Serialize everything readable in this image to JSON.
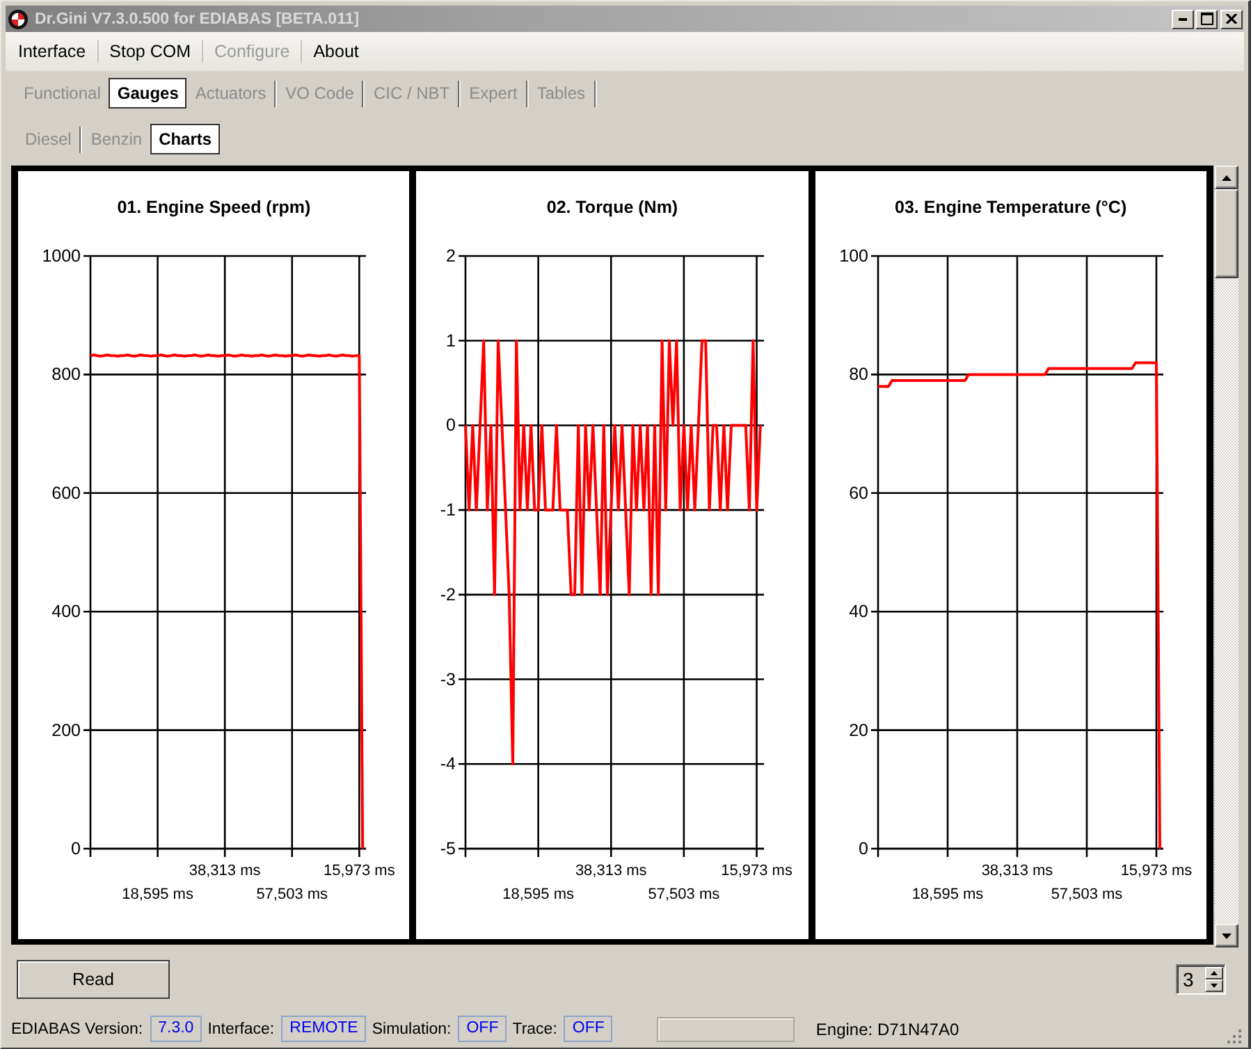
{
  "window": {
    "title": "Dr.Gini V7.3.0.500 for EDIABAS [BETA.011]"
  },
  "menu": [
    {
      "label": "Interface",
      "disabled": false
    },
    {
      "label": "Stop COM",
      "disabled": false
    },
    {
      "label": "Configure",
      "disabled": true
    },
    {
      "label": "About",
      "disabled": false
    }
  ],
  "tabs": [
    {
      "label": "Functional",
      "selected": false
    },
    {
      "label": "Gauges",
      "selected": true
    },
    {
      "label": "Actuators",
      "selected": false
    },
    {
      "label": "VO Code",
      "selected": false
    },
    {
      "label": "CIC / NBT",
      "selected": false
    },
    {
      "label": "Expert",
      "selected": false
    },
    {
      "label": "Tables",
      "selected": false
    }
  ],
  "sub_tabs": [
    {
      "label": "Diesel",
      "selected": false
    },
    {
      "label": "Benzin",
      "selected": false
    },
    {
      "label": "Charts",
      "selected": true
    }
  ],
  "charts": [
    {
      "chart_data": {
        "type": "line",
        "title": "01. Engine Speed (rpm)",
        "grid": true,
        "categories": [
          null,
          null,
          null,
          null,
          null,
          null,
          null,
          null,
          null,
          null,
          null,
          null,
          null,
          null,
          null,
          null,
          null,
          null,
          null,
          null,
          "18,595 ms",
          null,
          null,
          null,
          null,
          null,
          null,
          null,
          null,
          null,
          null,
          null,
          null,
          null,
          null,
          null,
          null,
          null,
          null,
          null,
          "38,313 ms",
          null,
          null,
          null,
          null,
          null,
          null,
          null,
          null,
          null,
          null,
          null,
          null,
          null,
          null,
          null,
          null,
          null,
          null,
          null,
          "57,503 ms",
          null,
          null,
          null,
          null,
          null,
          null,
          null,
          null,
          null,
          null,
          null,
          null,
          null,
          null,
          null,
          null,
          null,
          null,
          null,
          "15,973 ms",
          null
        ],
        "values": [
          832,
          833,
          832,
          831,
          832,
          833,
          832,
          832,
          831,
          832,
          832,
          833,
          832,
          831,
          832,
          833,
          832,
          832,
          831,
          832,
          832,
          833,
          832,
          831,
          832,
          833,
          832,
          832,
          831,
          832,
          832,
          833,
          832,
          831,
          832,
          833,
          832,
          832,
          831,
          832,
          832,
          833,
          832,
          831,
          832,
          833,
          832,
          832,
          831,
          832,
          832,
          833,
          832,
          831,
          832,
          833,
          832,
          832,
          831,
          832,
          832,
          833,
          832,
          831,
          832,
          833,
          832,
          832,
          831,
          832,
          832,
          833,
          832,
          831,
          832,
          833,
          832,
          832,
          831,
          832,
          832,
          0
        ],
        "ylim": [
          0,
          1000
        ],
        "yticks": [
          0,
          200,
          400,
          600,
          800,
          1000
        ]
      }
    },
    {
      "chart_data": {
        "type": "line",
        "title": "02. Torque (Nm)",
        "grid": true,
        "categories": [
          null,
          null,
          null,
          null,
          null,
          null,
          null,
          null,
          null,
          null,
          null,
          null,
          null,
          null,
          null,
          null,
          null,
          null,
          null,
          null,
          "18,595 ms",
          null,
          null,
          null,
          null,
          null,
          null,
          null,
          null,
          null,
          null,
          null,
          null,
          null,
          null,
          null,
          null,
          null,
          null,
          null,
          "38,313 ms",
          null,
          null,
          null,
          null,
          null,
          null,
          null,
          null,
          null,
          null,
          null,
          null,
          null,
          null,
          null,
          null,
          null,
          null,
          null,
          "57,503 ms",
          null,
          null,
          null,
          null,
          null,
          null,
          null,
          null,
          null,
          null,
          null,
          null,
          null,
          null,
          null,
          null,
          null,
          null,
          null,
          "15,973 ms",
          null
        ],
        "values": [
          0,
          -1,
          0,
          -1,
          0,
          1,
          -1,
          0,
          -2,
          1,
          0,
          -1,
          -2,
          -4,
          1,
          -1,
          0,
          -1,
          0,
          -1,
          -1,
          0,
          -1,
          -1,
          -1,
          0,
          -1,
          -1,
          -1,
          -2,
          -2,
          0,
          -2,
          0,
          -1,
          0,
          -1,
          -2,
          0,
          -2,
          -1,
          0,
          -1,
          0,
          -1,
          -2,
          0,
          -1,
          0,
          -1,
          0,
          -2,
          0,
          -2,
          1,
          -1,
          1,
          0,
          1,
          -1,
          0,
          -1,
          0,
          -1,
          0,
          1,
          1,
          -1,
          0,
          0,
          -1,
          0,
          -1,
          0,
          0,
          0,
          0,
          0,
          -1,
          1,
          -1,
          0
        ],
        "ylim": [
          -5,
          2
        ],
        "yticks": [
          -5,
          -4,
          -3,
          -2,
          -1,
          0,
          1,
          2
        ]
      }
    },
    {
      "chart_data": {
        "type": "line",
        "title": "03. Engine Temperature (°C)",
        "grid": true,
        "categories": [
          null,
          null,
          null,
          null,
          null,
          null,
          null,
          null,
          null,
          null,
          null,
          null,
          null,
          null,
          null,
          null,
          null,
          null,
          null,
          null,
          "18,595 ms",
          null,
          null,
          null,
          null,
          null,
          null,
          null,
          null,
          null,
          null,
          null,
          null,
          null,
          null,
          null,
          null,
          null,
          null,
          null,
          "38,313 ms",
          null,
          null,
          null,
          null,
          null,
          null,
          null,
          null,
          null,
          null,
          null,
          null,
          null,
          null,
          null,
          null,
          null,
          null,
          null,
          "57,503 ms",
          null,
          null,
          null,
          null,
          null,
          null,
          null,
          null,
          null,
          null,
          null,
          null,
          null,
          null,
          null,
          null,
          null,
          null,
          null,
          "15,973 ms",
          null
        ],
        "values": [
          78,
          78,
          78,
          78,
          79,
          79,
          79,
          79,
          79,
          79,
          79,
          79,
          79,
          79,
          79,
          79,
          79,
          79,
          79,
          79,
          79,
          79,
          79,
          79,
          79,
          79,
          80,
          80,
          80,
          80,
          80,
          80,
          80,
          80,
          80,
          80,
          80,
          80,
          80,
          80,
          80,
          80,
          80,
          80,
          80,
          80,
          80,
          80,
          80,
          81,
          81,
          81,
          81,
          81,
          81,
          81,
          81,
          81,
          81,
          81,
          81,
          81,
          81,
          81,
          81,
          81,
          81,
          81,
          81,
          81,
          81,
          81,
          81,
          81,
          82,
          82,
          82,
          82,
          82,
          82,
          82,
          0
        ],
        "ylim": [
          0,
          100
        ],
        "yticks": [
          0,
          20,
          40,
          60,
          80,
          100
        ]
      }
    }
  ],
  "read_button": {
    "label": "Read"
  },
  "chart_count": {
    "value": "3"
  },
  "status_bar": {
    "items": [
      {
        "label": "EDIABAS Version:",
        "value": "7.3.0"
      },
      {
        "label": "Interface:",
        "value": "REMOTE"
      },
      {
        "label": "Simulation:",
        "value": "OFF"
      },
      {
        "label": "Trace:",
        "value": "OFF"
      }
    ],
    "engine": "Engine: D71N47A0"
  }
}
